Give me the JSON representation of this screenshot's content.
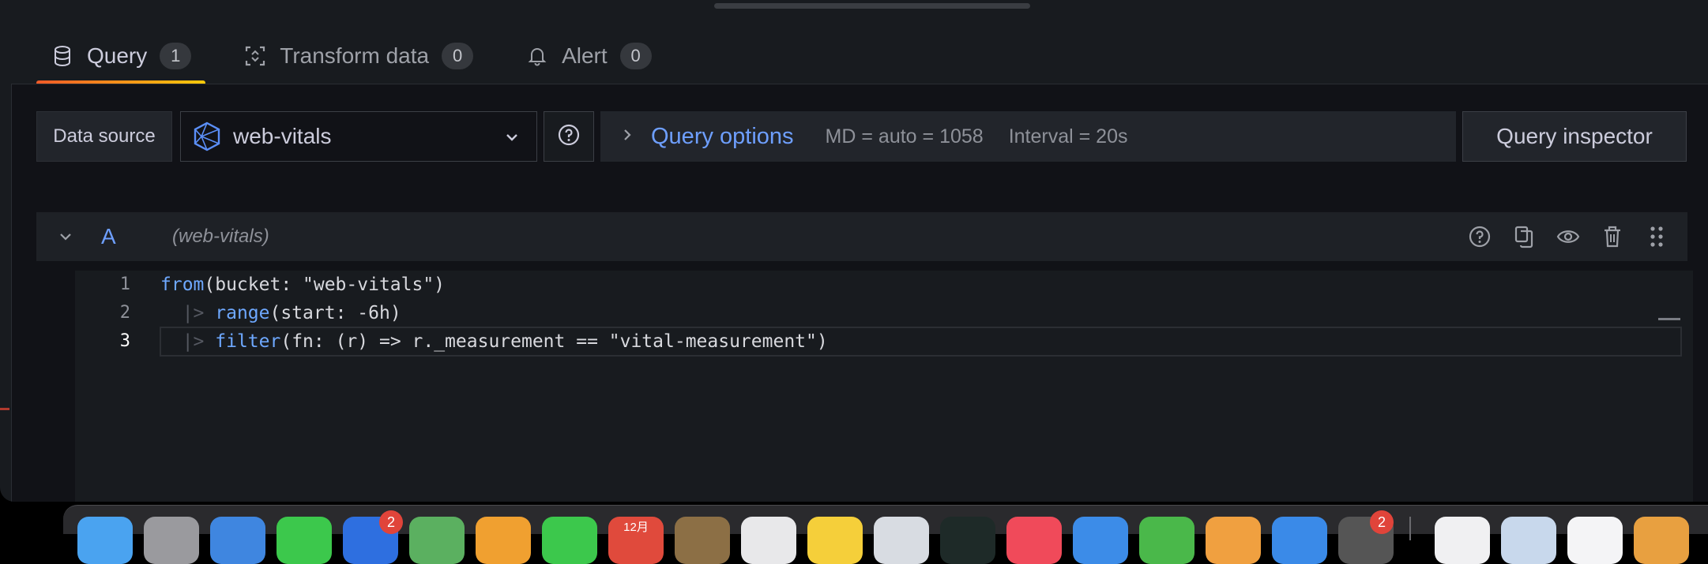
{
  "tabs": [
    {
      "label": "Query",
      "count": "1",
      "icon": "database-icon"
    },
    {
      "label": "Transform data",
      "count": "0",
      "icon": "transform-icon"
    },
    {
      "label": "Alert",
      "count": "0",
      "icon": "bell-icon"
    }
  ],
  "datasource": {
    "label": "Data source",
    "selected": "web-vitals"
  },
  "query_options": {
    "title": "Query options",
    "md": "MD = auto = 1058",
    "interval": "Interval = 20s"
  },
  "inspector_label": "Query inspector",
  "query_row": {
    "letter": "A",
    "datasource": "(web-vitals)"
  },
  "editor": {
    "line_numbers": [
      "1",
      "2",
      "3"
    ],
    "lines": [
      {
        "kw": "from",
        "rest": "(bucket: \"web-vitals\")"
      },
      {
        "guide": "  |> ",
        "kw": "range",
        "rest": "(start: -6h)"
      },
      {
        "guide": "  |> ",
        "kw": "filter",
        "rest": "(fn: (r) => r._measurement == \"vital-measurement\")"
      }
    ]
  },
  "dock": {
    "calendar_label": "12月",
    "badges": [
      "2",
      "2"
    ]
  },
  "colors": {
    "accent_blue": "#6e9fff",
    "tab_underline_start": "#f05a28",
    "tab_underline_end": "#fbca0a"
  }
}
